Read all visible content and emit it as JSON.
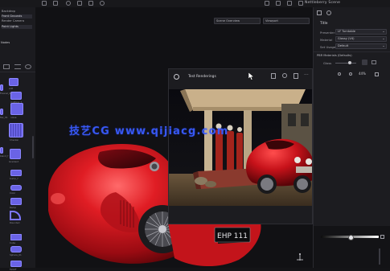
{
  "window": {
    "title": "Nettleberry Scene"
  },
  "left_panel": {
    "scene_items": [
      "Backdrop",
      "Front Grounds",
      "Render Camera",
      "Point Lights"
    ],
    "section_label": "Nodes",
    "node_labels": [
      "add",
      "multiply_f",
      "noise",
      "Checker",
      "Gradient",
      "bump_f",
      "Color",
      "Ramp",
      "Rounded",
      "Cube",
      "Sphere_01",
      "Falloff",
      "Fresnel_01",
      "Tex_01",
      "blend_f"
    ]
  },
  "viewport": {
    "tab_left": "Scene Overview",
    "tab_right": "Viewport"
  },
  "render_window": {
    "title": "Test Renderings",
    "zoom": "44%",
    "plate_text": "EHP 111"
  },
  "right_panel": {
    "header": "Title",
    "fields": [
      {
        "label": "Presenter",
        "value": "LF Turntable"
      },
      {
        "label": "Material",
        "value": "Glossy (V4)"
      },
      {
        "label": "Set Usage",
        "value": "Default"
      }
    ],
    "section": "PBR Materials (Defaults)",
    "row_label": "Gloss"
  },
  "watermark": {
    "text": "技艺CG  www.qijiacg.com"
  },
  "colors": {
    "accent": "#6a63e6",
    "car_red": "#d8141c",
    "panel": "#1c1c20",
    "background": "#111114",
    "watermark": "#3a5cff"
  }
}
